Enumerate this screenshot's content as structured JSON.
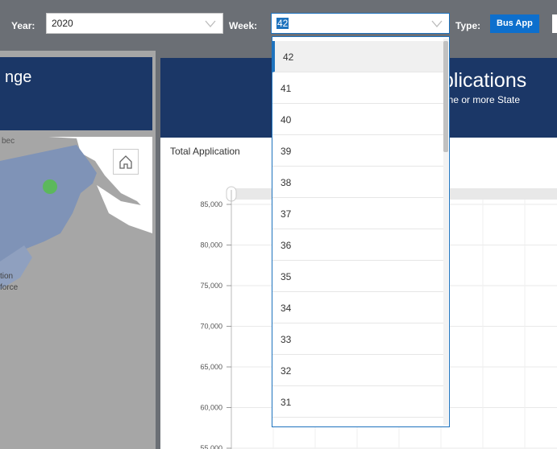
{
  "filters": {
    "year_label": "Year:",
    "year_value": "2020",
    "week_label": "Week:",
    "week_value": "42",
    "type_label": "Type:",
    "type_value": "Bus App"
  },
  "left_panel": {
    "title_fragment": "nge",
    "map_labels": [
      "bec",
      "tion",
      "force"
    ]
  },
  "right_panel": {
    "title_fragment": "plications",
    "subtitle_fragment": "one or more State",
    "chart_title_fragment": "Total Application"
  },
  "week_options": [
    "42",
    "41",
    "40",
    "39",
    "38",
    "37",
    "36",
    "35",
    "34",
    "33",
    "32",
    "31"
  ],
  "chart_data": {
    "type": "line",
    "title": "Total Application",
    "yticks": [
      85000,
      80000,
      75000,
      70000,
      65000,
      60000,
      55000
    ],
    "ytick_labels": [
      "85,000",
      "80,000",
      "75,000",
      "70,000",
      "65,000",
      "60,000",
      "55,000"
    ],
    "series": []
  },
  "colors": {
    "header_navy": "#1b3767",
    "accent_blue": "#1e73be",
    "bg_gray": "#6b6f75",
    "map_land": "#a6a6a6",
    "map_highlight": "#7f93b7",
    "marker_green": "#5cb85c"
  }
}
